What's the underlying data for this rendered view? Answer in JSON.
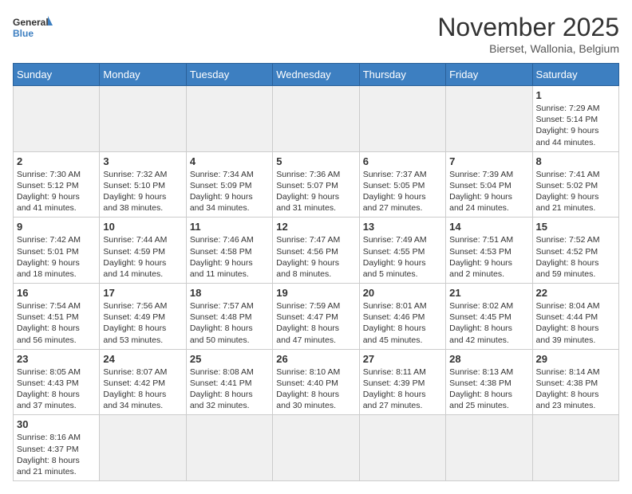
{
  "header": {
    "logo_general": "General",
    "logo_blue": "Blue",
    "month": "November 2025",
    "location": "Bierset, Wallonia, Belgium"
  },
  "weekdays": [
    "Sunday",
    "Monday",
    "Tuesday",
    "Wednesday",
    "Thursday",
    "Friday",
    "Saturday"
  ],
  "weeks": [
    [
      {
        "day": "",
        "info": ""
      },
      {
        "day": "",
        "info": ""
      },
      {
        "day": "",
        "info": ""
      },
      {
        "day": "",
        "info": ""
      },
      {
        "day": "",
        "info": ""
      },
      {
        "day": "",
        "info": ""
      },
      {
        "day": "1",
        "info": "Sunrise: 7:29 AM\nSunset: 5:14 PM\nDaylight: 9 hours\nand 44 minutes."
      }
    ],
    [
      {
        "day": "2",
        "info": "Sunrise: 7:30 AM\nSunset: 5:12 PM\nDaylight: 9 hours\nand 41 minutes."
      },
      {
        "day": "3",
        "info": "Sunrise: 7:32 AM\nSunset: 5:10 PM\nDaylight: 9 hours\nand 38 minutes."
      },
      {
        "day": "4",
        "info": "Sunrise: 7:34 AM\nSunset: 5:09 PM\nDaylight: 9 hours\nand 34 minutes."
      },
      {
        "day": "5",
        "info": "Sunrise: 7:36 AM\nSunset: 5:07 PM\nDaylight: 9 hours\nand 31 minutes."
      },
      {
        "day": "6",
        "info": "Sunrise: 7:37 AM\nSunset: 5:05 PM\nDaylight: 9 hours\nand 27 minutes."
      },
      {
        "day": "7",
        "info": "Sunrise: 7:39 AM\nSunset: 5:04 PM\nDaylight: 9 hours\nand 24 minutes."
      },
      {
        "day": "8",
        "info": "Sunrise: 7:41 AM\nSunset: 5:02 PM\nDaylight: 9 hours\nand 21 minutes."
      }
    ],
    [
      {
        "day": "9",
        "info": "Sunrise: 7:42 AM\nSunset: 5:01 PM\nDaylight: 9 hours\nand 18 minutes."
      },
      {
        "day": "10",
        "info": "Sunrise: 7:44 AM\nSunset: 4:59 PM\nDaylight: 9 hours\nand 14 minutes."
      },
      {
        "day": "11",
        "info": "Sunrise: 7:46 AM\nSunset: 4:58 PM\nDaylight: 9 hours\nand 11 minutes."
      },
      {
        "day": "12",
        "info": "Sunrise: 7:47 AM\nSunset: 4:56 PM\nDaylight: 9 hours\nand 8 minutes."
      },
      {
        "day": "13",
        "info": "Sunrise: 7:49 AM\nSunset: 4:55 PM\nDaylight: 9 hours\nand 5 minutes."
      },
      {
        "day": "14",
        "info": "Sunrise: 7:51 AM\nSunset: 4:53 PM\nDaylight: 9 hours\nand 2 minutes."
      },
      {
        "day": "15",
        "info": "Sunrise: 7:52 AM\nSunset: 4:52 PM\nDaylight: 8 hours\nand 59 minutes."
      }
    ],
    [
      {
        "day": "16",
        "info": "Sunrise: 7:54 AM\nSunset: 4:51 PM\nDaylight: 8 hours\nand 56 minutes."
      },
      {
        "day": "17",
        "info": "Sunrise: 7:56 AM\nSunset: 4:49 PM\nDaylight: 8 hours\nand 53 minutes."
      },
      {
        "day": "18",
        "info": "Sunrise: 7:57 AM\nSunset: 4:48 PM\nDaylight: 8 hours\nand 50 minutes."
      },
      {
        "day": "19",
        "info": "Sunrise: 7:59 AM\nSunset: 4:47 PM\nDaylight: 8 hours\nand 47 minutes."
      },
      {
        "day": "20",
        "info": "Sunrise: 8:01 AM\nSunset: 4:46 PM\nDaylight: 8 hours\nand 45 minutes."
      },
      {
        "day": "21",
        "info": "Sunrise: 8:02 AM\nSunset: 4:45 PM\nDaylight: 8 hours\nand 42 minutes."
      },
      {
        "day": "22",
        "info": "Sunrise: 8:04 AM\nSunset: 4:44 PM\nDaylight: 8 hours\nand 39 minutes."
      }
    ],
    [
      {
        "day": "23",
        "info": "Sunrise: 8:05 AM\nSunset: 4:43 PM\nDaylight: 8 hours\nand 37 minutes."
      },
      {
        "day": "24",
        "info": "Sunrise: 8:07 AM\nSunset: 4:42 PM\nDaylight: 8 hours\nand 34 minutes."
      },
      {
        "day": "25",
        "info": "Sunrise: 8:08 AM\nSunset: 4:41 PM\nDaylight: 8 hours\nand 32 minutes."
      },
      {
        "day": "26",
        "info": "Sunrise: 8:10 AM\nSunset: 4:40 PM\nDaylight: 8 hours\nand 30 minutes."
      },
      {
        "day": "27",
        "info": "Sunrise: 8:11 AM\nSunset: 4:39 PM\nDaylight: 8 hours\nand 27 minutes."
      },
      {
        "day": "28",
        "info": "Sunrise: 8:13 AM\nSunset: 4:38 PM\nDaylight: 8 hours\nand 25 minutes."
      },
      {
        "day": "29",
        "info": "Sunrise: 8:14 AM\nSunset: 4:38 PM\nDaylight: 8 hours\nand 23 minutes."
      }
    ],
    [
      {
        "day": "30",
        "info": "Sunrise: 8:16 AM\nSunset: 4:37 PM\nDaylight: 8 hours\nand 21 minutes."
      },
      {
        "day": "",
        "info": ""
      },
      {
        "day": "",
        "info": ""
      },
      {
        "day": "",
        "info": ""
      },
      {
        "day": "",
        "info": ""
      },
      {
        "day": "",
        "info": ""
      },
      {
        "day": "",
        "info": ""
      }
    ]
  ]
}
